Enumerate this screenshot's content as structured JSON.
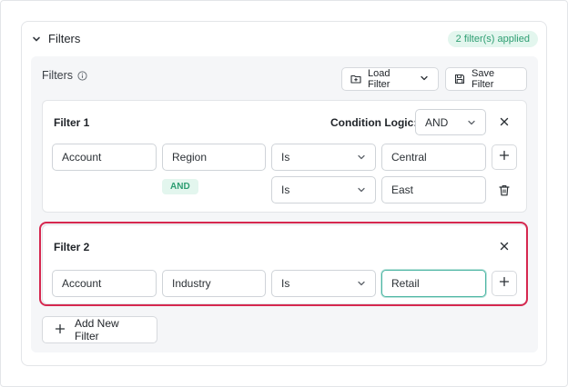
{
  "panel": {
    "title": "Filters",
    "applied_badge": "2 filter(s) applied"
  },
  "inner": {
    "label": "Filters",
    "load_filter_label": "Load Filter",
    "save_filter_label": "Save Filter"
  },
  "filter1": {
    "title": "Filter 1",
    "logic_label": "Condition Logic:",
    "logic_value": "AND",
    "row1": {
      "entity": "Account",
      "field": "Region",
      "operator": "Is",
      "value": "Central"
    },
    "and_badge": "AND",
    "row2": {
      "operator": "Is",
      "value": "East"
    }
  },
  "filter2": {
    "title": "Filter 2",
    "row1": {
      "entity": "Account",
      "field": "Industry",
      "operator": "Is",
      "value": "Retail"
    }
  },
  "add_filter_label": "Add New Filter",
  "colors": {
    "accent_green": "#2e9e72",
    "badge_bg": "#e3f6ee",
    "highlight_red": "#d6284f",
    "focus_teal": "#4cb5a3"
  }
}
